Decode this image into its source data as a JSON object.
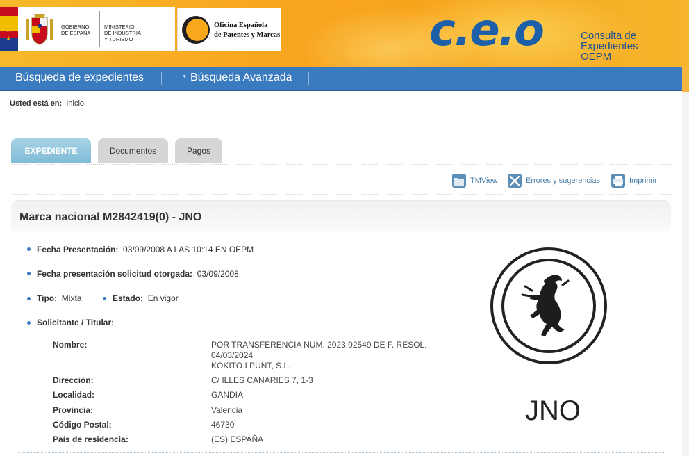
{
  "header": {
    "gov_line1": "GOBIERNO",
    "gov_line2": "DE ESPAÑA",
    "ministry_line1": "MINISTERIO",
    "ministry_line2": "DE INDUSTRIA",
    "ministry_line3": "Y TURISMO",
    "oepm_line1": "Oficina Española",
    "oepm_line2": "de Patentes y Marcas",
    "ceo_logo": "c.e.o",
    "ceo_sub_line1": "Consulta de",
    "ceo_sub_line2": "Expedientes",
    "ceo_sub_line3": "OEPM"
  },
  "nav": {
    "items": [
      {
        "label": "Búsqueda de expedientes"
      },
      {
        "label": "Búsqueda Avanzada"
      }
    ]
  },
  "breadcrumb": {
    "prefix": "Usted está en:",
    "current": "Inicio"
  },
  "tabs": [
    {
      "label": "EXPEDIENTE"
    },
    {
      "label": "Documentos"
    },
    {
      "label": "Pagos"
    }
  ],
  "tools": [
    {
      "label": "TMView",
      "icon": "folder-icon"
    },
    {
      "label": "Errores y sugerencias",
      "icon": "tools-icon"
    },
    {
      "label": "Imprimir",
      "icon": "printer-icon"
    }
  ],
  "record": {
    "title": "Marca nacional M2842419(0) - JNO",
    "fecha_presentacion_label": "Fecha Presentación:",
    "fecha_presentacion_value": "03/09/2008 A LAS 10:14 EN OEPM",
    "fecha_otorgada_label": "Fecha presentación solicitud otorgada:",
    "fecha_otorgada_value": "03/09/2008",
    "tipo_label": "Tipo:",
    "tipo_value": "Mixta",
    "estado_label": "Estado:",
    "estado_value": "En vigor",
    "solicitante_label": "Solicitante / Titular:",
    "holder": {
      "nombre_label": "Nombre:",
      "nombre_line1": "POR TRANSFERENCIA NUM. 2023.02549 DE F. RESOL.",
      "nombre_line2": "04/03/2024",
      "nombre_line3": "KOKITO I PUNT, S.L.",
      "direccion_label": "Dirección:",
      "direccion_value": "C/ ILLES CANARIES 7, 1-3",
      "localidad_label": "Localidad:",
      "localidad_value": "GANDIA",
      "provincia_label": "Provincia:",
      "provincia_value": "Valencia",
      "cp_label": "Código Postal:",
      "cp_value": "46730",
      "pais_label": "País de residencia:",
      "pais_value": "(ES) ESPAÑA"
    }
  },
  "trademark_image": {
    "text": "JNO"
  },
  "colors": {
    "nav_blue": "#3a7bbf",
    "banner_orange": "#f8a51f",
    "link_blue": "#4b7fa8",
    "ceo_blue": "#1d5fa8"
  }
}
